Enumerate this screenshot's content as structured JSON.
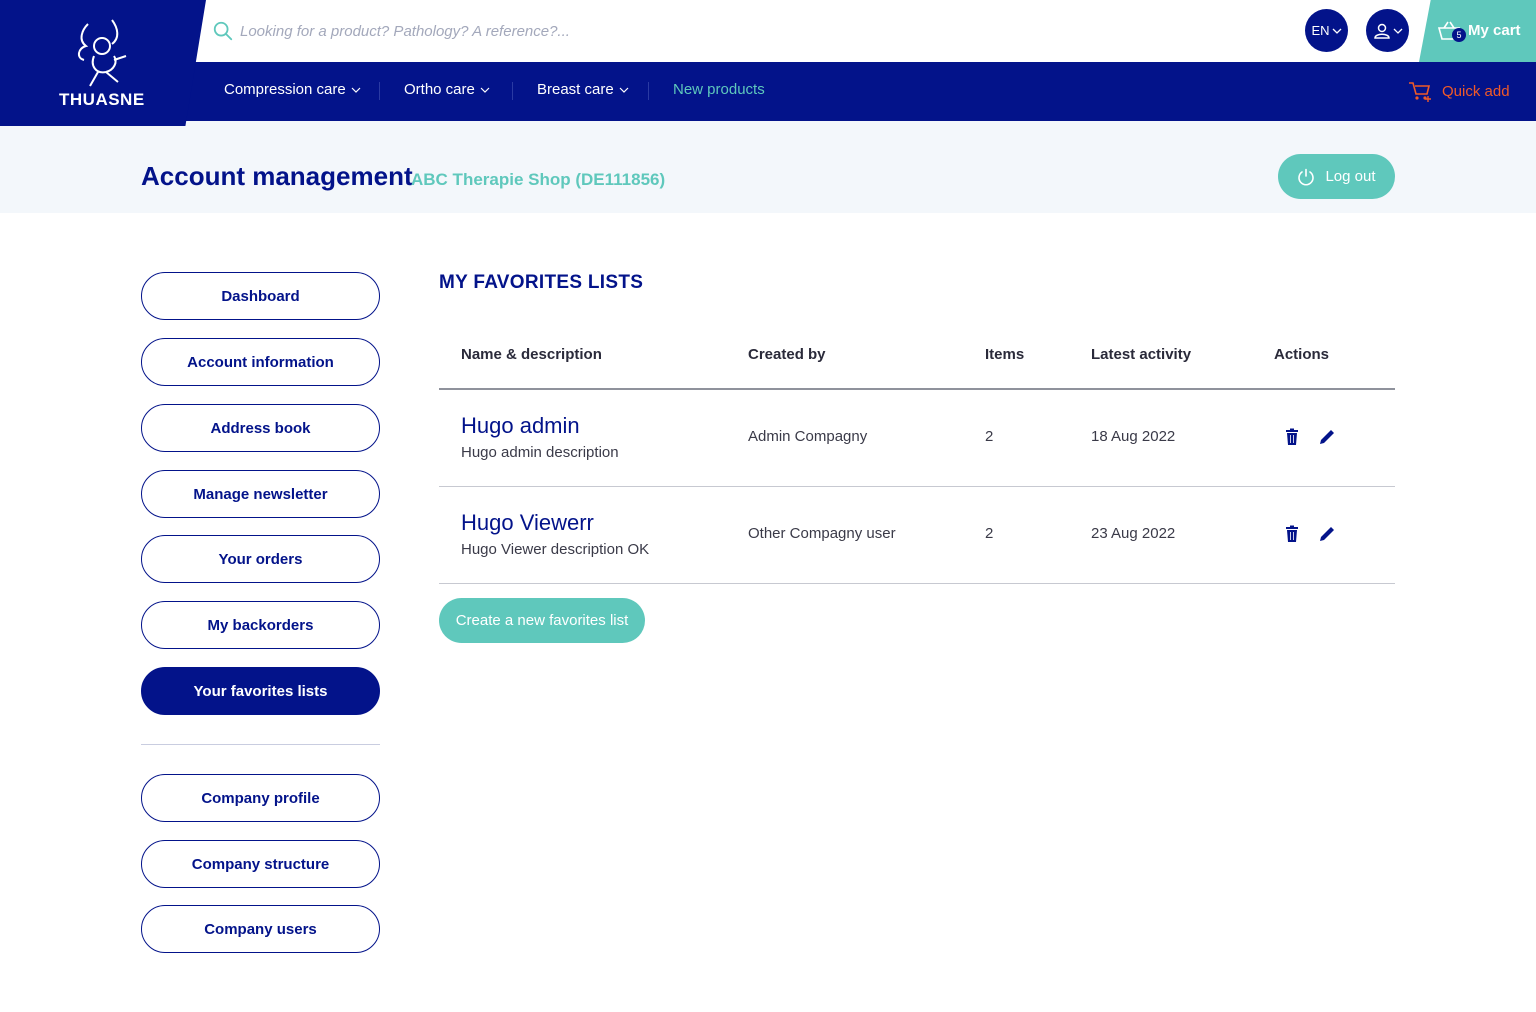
{
  "brand": {
    "name": "THUASNE",
    "primary": "#03138a",
    "accent": "#5fc8bc",
    "orange": "#f05a28"
  },
  "search": {
    "placeholder": "Looking for a product? Pathology? A reference?..."
  },
  "header": {
    "lang": "EN",
    "cart_label": "My cart",
    "cart_count": "5"
  },
  "nav": {
    "items": [
      {
        "label": "Compression care"
      },
      {
        "label": "Ortho care"
      },
      {
        "label": "Breast care"
      },
      {
        "label": "New products"
      }
    ],
    "quick_add": "Quick add"
  },
  "account": {
    "title": "Account management",
    "shop": "ABC Therapie Shop (DE111856)",
    "logout": "Log out"
  },
  "sidebar": {
    "items": [
      {
        "label": "Dashboard"
      },
      {
        "label": "Account information"
      },
      {
        "label": "Address book"
      },
      {
        "label": "Manage newsletter"
      },
      {
        "label": "Your orders"
      },
      {
        "label": "My backorders"
      },
      {
        "label": "Your favorites lists"
      }
    ],
    "company_items": [
      {
        "label": "Company profile"
      },
      {
        "label": "Company structure"
      },
      {
        "label": "Company users"
      }
    ]
  },
  "favorites": {
    "title": "MY FAVORITES LISTS",
    "headers": [
      "Name & description",
      "Created by",
      "Items",
      "Latest activity",
      "Actions"
    ],
    "rows": [
      {
        "name": "Hugo admin",
        "description": "Hugo admin description",
        "created_by": "Admin Compagny",
        "items": "2",
        "latest": "18 Aug 2022"
      },
      {
        "name": "Hugo Viewerr",
        "description": "Hugo Viewer description OK",
        "created_by": "Other Compagny user",
        "items": "2",
        "latest": "23 Aug 2022"
      }
    ],
    "create_label": "Create a new favorites list"
  }
}
